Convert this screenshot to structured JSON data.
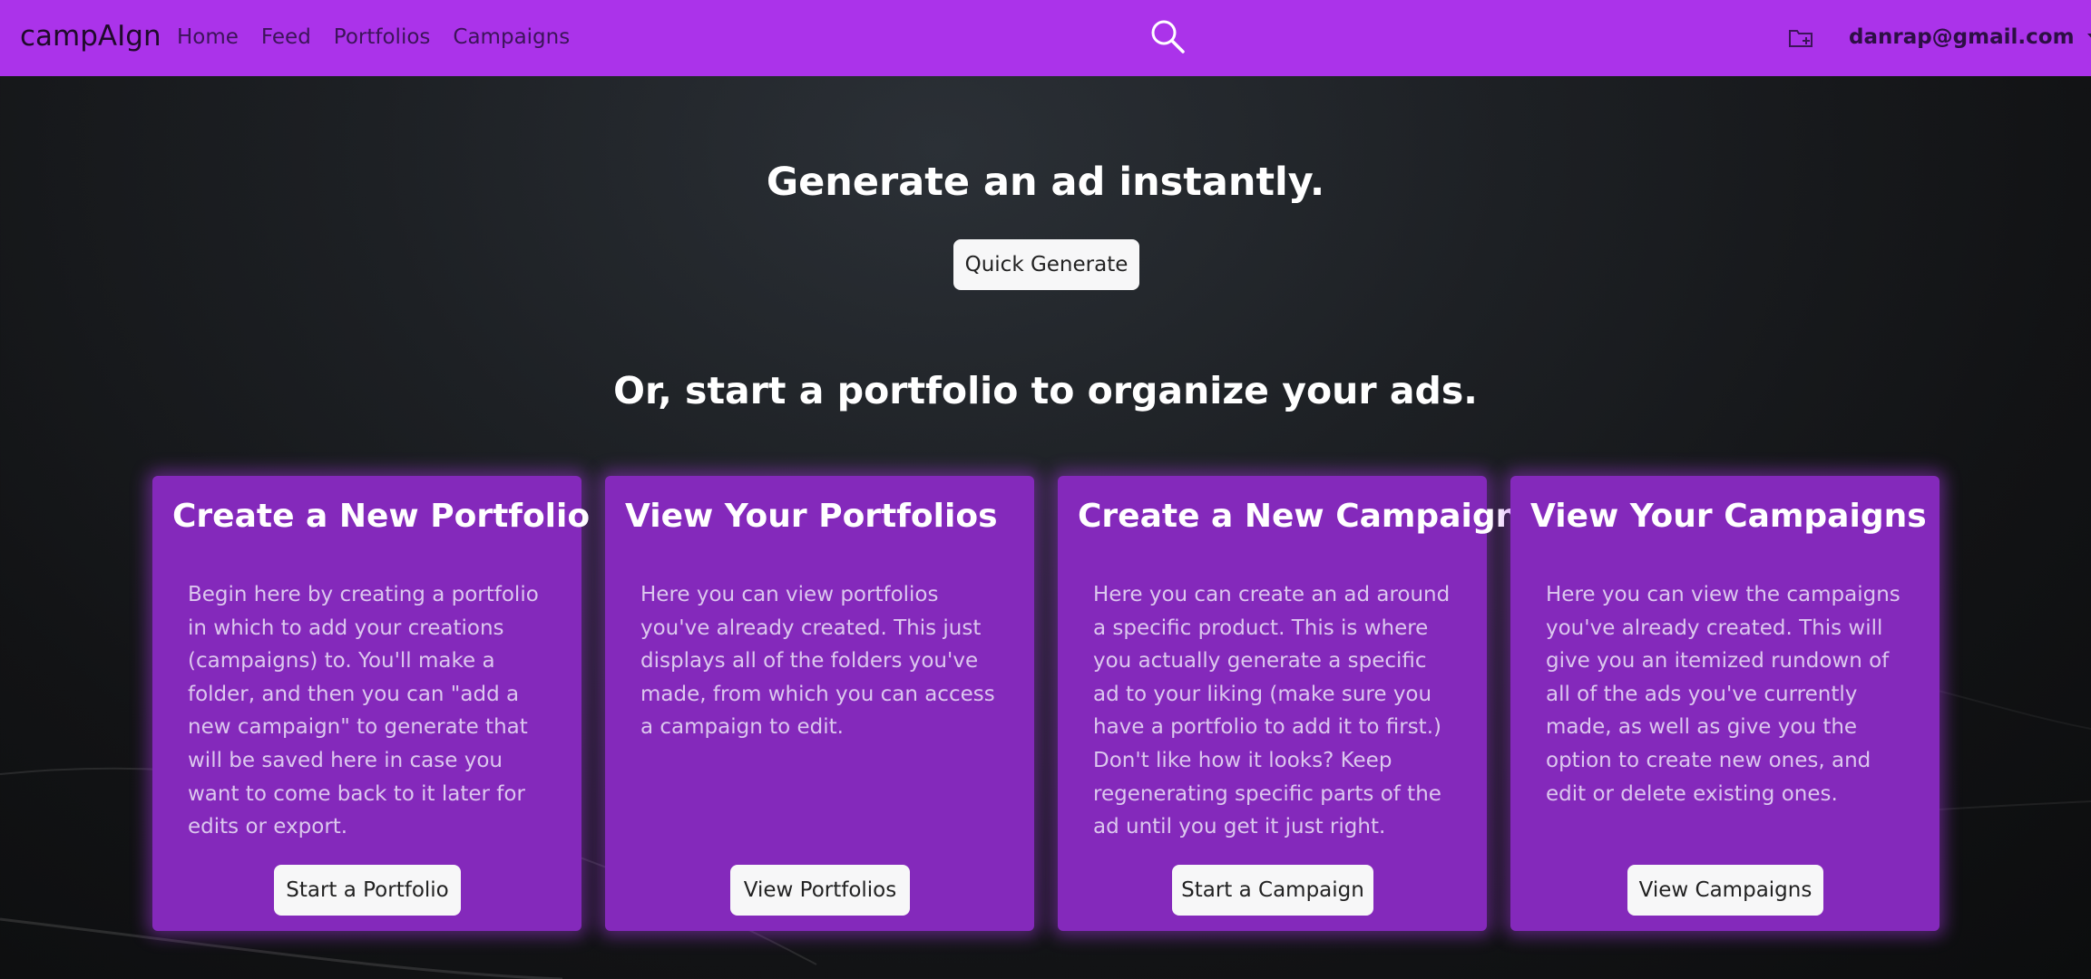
{
  "navbar": {
    "brand": "campAIgn",
    "links": [
      "Home",
      "Feed",
      "Portfolios",
      "Campaigns"
    ],
    "search_icon": "search-icon",
    "folder_icon": "folder-icon",
    "user_email": "danrap@gmail.com",
    "bg_color": "#ab33ea"
  },
  "hero": {
    "title": "Generate an ad instantly.",
    "button_label": "Quick Generate"
  },
  "section": {
    "title": "Or, start a portfolio to organize your ads."
  },
  "cards": [
    {
      "title": "Create a New Portfolio",
      "description": "Begin here by creating a portfolio in which to add your creations (campaigns) to. You'll make a folder, and then you can \"add a new campaign\" to generate that will be saved here in case you want to come back to it later for edits or export.",
      "button_label": "Start a Portfolio"
    },
    {
      "title": "View Your Portfolios",
      "description": "Here you can view portfolios you've already created. This just displays all of the folders you've made, from which you can access a campaign to edit.",
      "button_label": "View Portfolios"
    },
    {
      "title": "Create a New Campaign",
      "description": "Here you can create an ad around a specific product. This is where you actually generate a specific ad to your liking (make sure you have a portfolio to add it to first.) Don't like how it looks? Keep regenerating specific parts of the ad until you get it just right.",
      "button_label": "Start a Campaign"
    },
    {
      "title": "View Your Campaigns",
      "description": "Here you can view the campaigns you've already created. This will give you an itemized rundown of all of the ads you've currently made, as well as give you the option to create new ones, and edit or delete existing ones.",
      "button_label": "View Campaigns"
    }
  ],
  "colors": {
    "card_bg": "#8429bb",
    "accent": "#ab33ea"
  }
}
